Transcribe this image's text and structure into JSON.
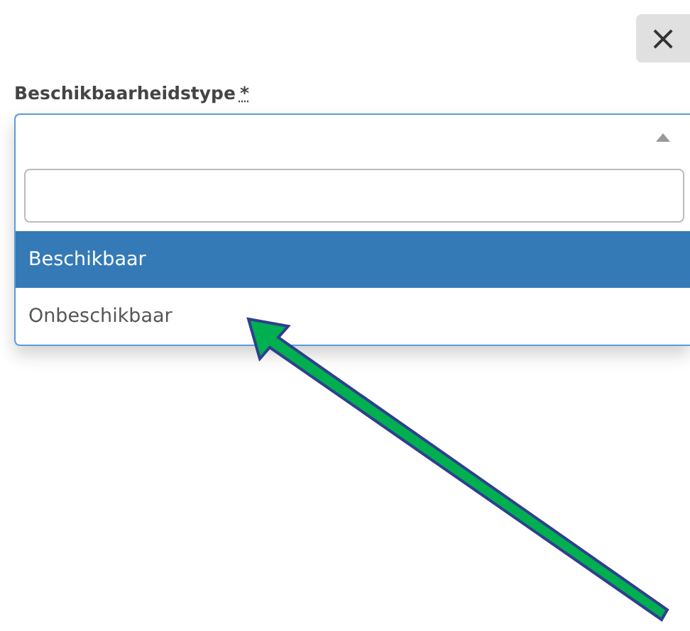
{
  "close_button": {
    "symbol": "×"
  },
  "field": {
    "label": "Beschikbaarheidstype",
    "required_mark": "*",
    "expanded": true
  },
  "dropdown": {
    "options": [
      {
        "label": "Beschikbaar",
        "selected": true
      },
      {
        "label": "Onbeschikbaar",
        "selected": false
      }
    ]
  },
  "annotation": {
    "kind": "arrow",
    "color": "#00b050"
  }
}
